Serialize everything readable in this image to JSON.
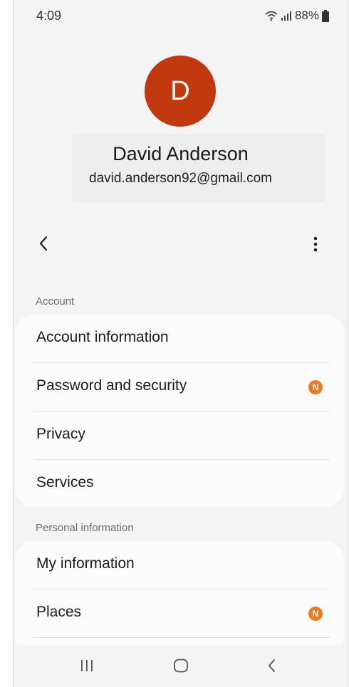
{
  "status_bar": {
    "time": "4:09",
    "battery": "88%",
    "icons": [
      "wifi-icon",
      "signal-icon",
      "battery-icon"
    ]
  },
  "profile": {
    "avatar_initial": "D",
    "avatar_color": "#c2380f",
    "name": "David Anderson",
    "email": "david.anderson92@gmail.com"
  },
  "toolbar": {
    "back_icon": "chevron-left-icon",
    "more_icon": "more-vertical-icon"
  },
  "sections": {
    "account": {
      "label": "Account",
      "items": [
        {
          "label": "Account information"
        },
        {
          "label": "Password and security",
          "badge": "N"
        },
        {
          "label": "Privacy"
        },
        {
          "label": "Services"
        }
      ]
    },
    "personal": {
      "label": "Personal information",
      "items": [
        {
          "label": "My information"
        },
        {
          "label": "Places",
          "badge": "N"
        }
      ]
    }
  },
  "colors": {
    "badge": "#f07a1f",
    "background": "#f4f4f4",
    "card": "#fcfcfc"
  },
  "nav_bar": {
    "buttons": [
      "recent-apps-icon",
      "home-icon",
      "back-icon"
    ]
  }
}
